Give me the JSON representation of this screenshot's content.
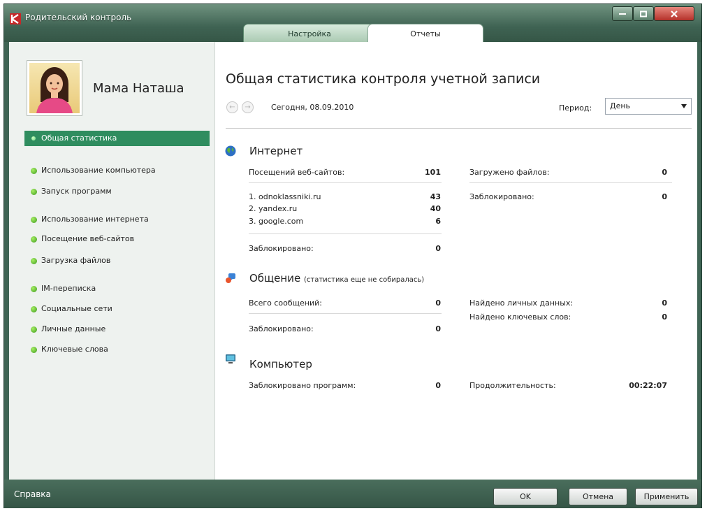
{
  "window": {
    "title": "Родительский контроль",
    "tabs": [
      {
        "label": "Настройка"
      },
      {
        "label": "Отчеты"
      }
    ]
  },
  "user": {
    "name": "Мама Наташа"
  },
  "sidebar": {
    "items": [
      {
        "label": "Общая статистика"
      },
      {
        "label": "Использование компьютера"
      },
      {
        "label": "Запуск программ"
      },
      {
        "label": "Использование интернета"
      },
      {
        "label": "Посещение веб-сайтов"
      },
      {
        "label": "Загрузка файлов"
      },
      {
        "label": "IM-переписка"
      },
      {
        "label": "Социальные сети"
      },
      {
        "label": "Личные данные"
      },
      {
        "label": "Ключевые слова"
      }
    ]
  },
  "main": {
    "heading": "Общая статистика контроля учетной записи",
    "date": "Сегодня, 08.09.2010",
    "period_label": "Период:",
    "period_value": "День",
    "internet": {
      "title": "Интернет",
      "visits_label": "Посещений веб-сайтов:",
      "visits_value": "101",
      "sites": [
        {
          "label": "1. odnoklassniki.ru",
          "value": "43"
        },
        {
          "label": "2. yandex.ru",
          "value": "40"
        },
        {
          "label": "3. google.com",
          "value": "6"
        }
      ],
      "blocked_label": "Заблокировано:",
      "blocked_value": "0",
      "downloads_label": "Загружено файлов:",
      "downloads_value": "0",
      "downloads_blocked_label": "Заблокировано:",
      "downloads_blocked_value": "0"
    },
    "communication": {
      "title": "Общение",
      "note": "(статистика еще не собиралась)",
      "messages_label": "Всего сообщений:",
      "messages_value": "0",
      "blocked_label": "Заблокировано:",
      "blocked_value": "0",
      "personal_label": "Найдено личных данных:",
      "personal_value": "0",
      "keywords_label": "Найдено ключевых слов:",
      "keywords_value": "0"
    },
    "computer": {
      "title": "Компьютер",
      "blocked_programs_label": "Заблокировано программ:",
      "blocked_programs_value": "0",
      "duration_label": "Продолжительность:",
      "duration_value": "00:22:07"
    }
  },
  "footer": {
    "help": "Справка",
    "ok": "OK",
    "cancel": "Отмена",
    "apply": "Применить"
  }
}
